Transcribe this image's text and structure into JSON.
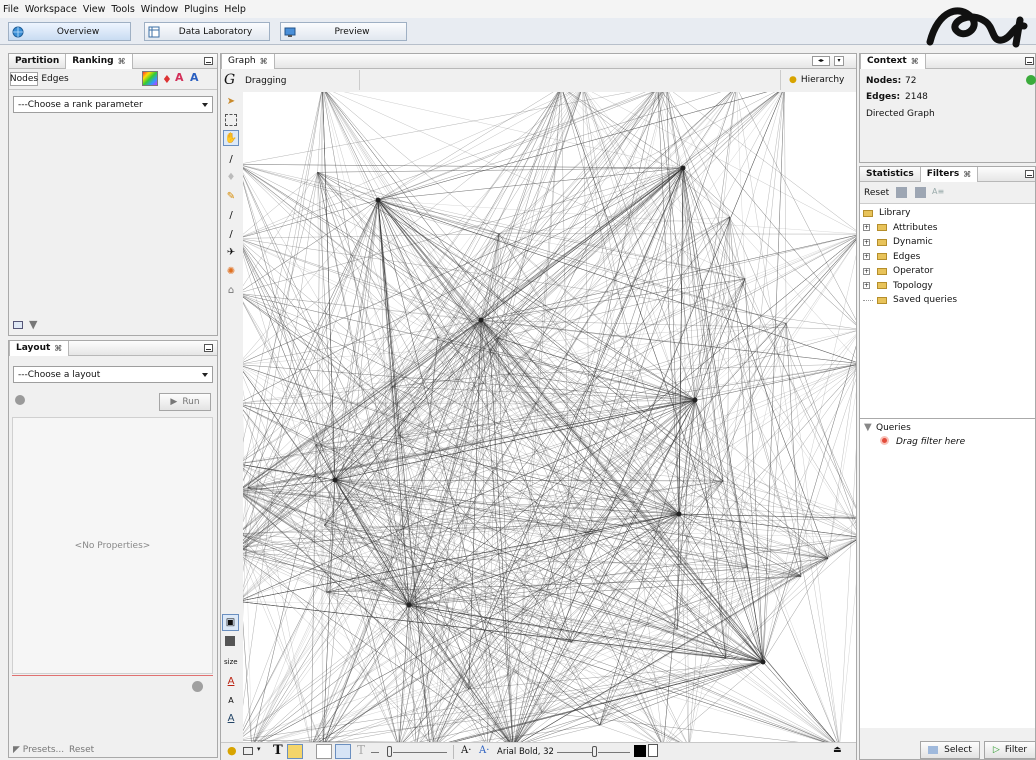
{
  "menu": [
    "File",
    "Workspace",
    "View",
    "Tools",
    "Window",
    "Plugins",
    "Help"
  ],
  "workspace_tabs": [
    {
      "label": "Overview",
      "active": true
    },
    {
      "label": "Data Laboratory",
      "active": false
    },
    {
      "label": "Preview",
      "active": false
    }
  ],
  "left_top": {
    "tabs": [
      "Partition",
      "Ranking"
    ],
    "nodes_label": "Nodes",
    "edges_label": "Edges",
    "rank_select": "---Choose a rank parameter"
  },
  "layout_panel": {
    "title": "Layout",
    "select": "---Choose a layout",
    "run": "Run",
    "no_properties": "<No Properties>",
    "presets": "Presets...",
    "reset": "Reset"
  },
  "graph": {
    "tab": "Graph",
    "mode": "Dragging",
    "hierarchy": "Hierarchy",
    "side_label": "size",
    "font_label": "Arial Bold, 32"
  },
  "context": {
    "title": "Context",
    "nodes_label": "Nodes:",
    "nodes_value": "72",
    "edges_label": "Edges:",
    "edges_value": "2148",
    "type": "Directed Graph"
  },
  "filters_panel": {
    "tabs": [
      "Statistics",
      "Filters"
    ],
    "reset": "Reset",
    "library": "Library",
    "items": [
      "Attributes",
      "Dynamic",
      "Edges",
      "Operator",
      "Topology"
    ],
    "saved": "Saved queries",
    "queries": "Queries",
    "drag_hint": "Drag filter here",
    "select_btn": "Select",
    "filter_btn": "Filter"
  },
  "colors": {
    "accent": "#6e9ad2",
    "graph_bg": "#ffffff",
    "edge": "#3a3a3a"
  }
}
